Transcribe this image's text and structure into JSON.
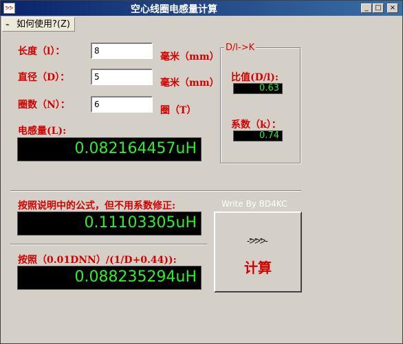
{
  "window": {
    "title": "空心线圈电感量计算",
    "icon_name": "app-coil-icon",
    "controls": {
      "minimize": "_",
      "maximize": "□",
      "close": "×"
    }
  },
  "menu": {
    "help_label": "如何使用?(Z)"
  },
  "inputs": {
    "length": {
      "label": "长度（l）：",
      "value": "8",
      "unit": "毫米（mm）"
    },
    "diameter": {
      "label": "直径（D）：",
      "value": "5",
      "unit": "毫米（mm）"
    },
    "turns": {
      "label": "圈数（N）：",
      "value": "6",
      "unit": "圈（T）"
    }
  },
  "inductance": {
    "label": "电感量(L):",
    "value": "0.082164457uH"
  },
  "ratio_group": {
    "title": "D/l->K",
    "ratio_label": "比值(D/l):",
    "ratio_value": "0.63",
    "coef_label": "系数（k）：",
    "coef_value": "0.74"
  },
  "formula1": {
    "label": "按照说明中的公式，但不用系数修正:",
    "value": "0.11103305uH"
  },
  "credit": "Write By BD4KC",
  "formula2": {
    "label": "按照（0.01DNN）/(1/D+0.44)):",
    "value": "0.088235294uH"
  },
  "calc_button": {
    "label": "计算",
    "icon_name": "coil-icon"
  },
  "colors": {
    "label_red": "#d40000",
    "lcd_green": "#2cf02c",
    "lcd_bg": "#000000",
    "face": "#d4d0c8",
    "title_blue": "#0a246a"
  }
}
